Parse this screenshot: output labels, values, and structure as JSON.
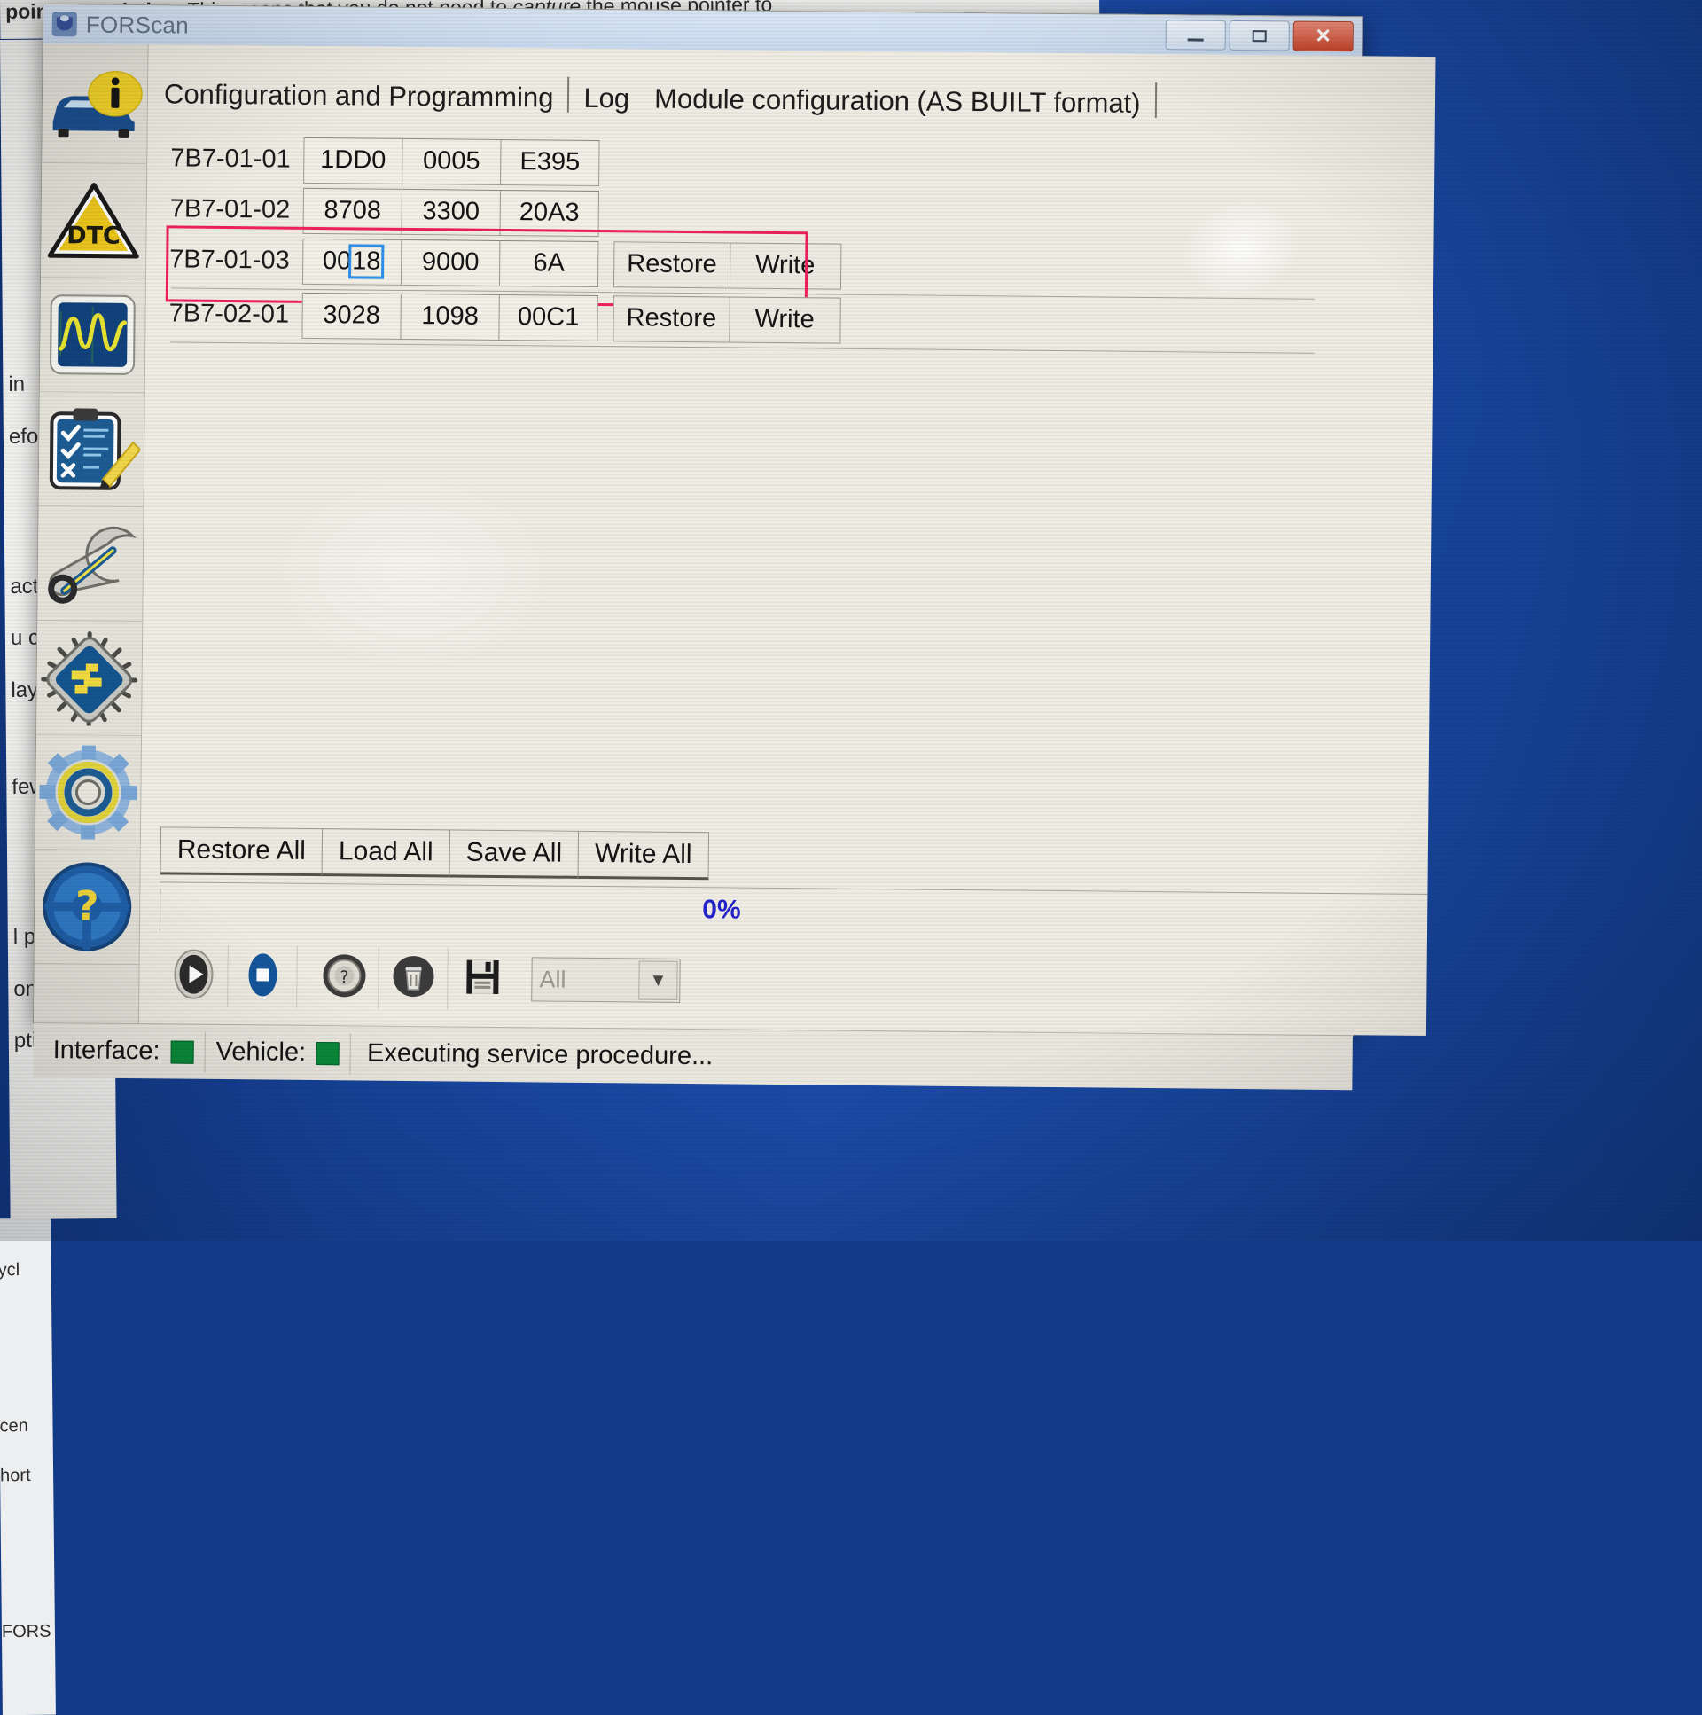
{
  "window": {
    "title": "FORScan",
    "app_icon": "forscan-logo-icon",
    "minimize_label": "",
    "maximize_label": "",
    "close_label": "✕"
  },
  "background": {
    "top_text_plain_1": "pointer emulation.",
    "top_text_plain_2": " This means that you do not need to ",
    "top_text_italic": "capture",
    "top_text_plain_3": " the mouse pointer to",
    "left_fragments": [
      "ycl",
      "cen",
      "hort",
      "FORS"
    ],
    "right_fragments": [
      "in",
      "efo",
      "acti",
      "u ca",
      "lays",
      "few",
      "l per",
      "omm",
      "ption"
    ]
  },
  "sidebar": {
    "items": [
      {
        "name": "vehicle-info",
        "icon": "car-info-icon"
      },
      {
        "name": "dtc-codes",
        "icon": "dtc-warning-triangle-icon"
      },
      {
        "name": "oscilloscope",
        "icon": "oscilloscope-icon"
      },
      {
        "name": "tests",
        "icon": "clipboard-checklist-pencil-icon"
      },
      {
        "name": "service-procedures",
        "icon": "wrench-icon"
      },
      {
        "name": "configuration-programming",
        "icon": "chip-icon"
      },
      {
        "name": "settings",
        "icon": "gear-icon"
      },
      {
        "name": "help",
        "icon": "steering-wheel-question-icon"
      }
    ]
  },
  "tabs": [
    {
      "label": "Configuration and Programming",
      "active": false
    },
    {
      "label": "Log",
      "active": false
    },
    {
      "label": "Module configuration (AS BUILT format)",
      "active": true
    }
  ],
  "asbuilt": {
    "rows": [
      {
        "id": "7B7-01-01",
        "values": [
          "1DD0",
          "0005",
          "E395"
        ],
        "has_buttons": false,
        "highlighted": false
      },
      {
        "id": "7B7-01-02",
        "values": [
          "8708",
          "3300",
          "20A3"
        ],
        "has_buttons": false,
        "highlighted": false
      },
      {
        "id": "7B7-01-03",
        "values": [
          "0018",
          "9000",
          "6A"
        ],
        "selection": {
          "cell": 0,
          "prefix": "00",
          "selected_text": "18"
        },
        "has_buttons": true,
        "restore_label": "Restore",
        "write_label": "Write",
        "highlighted": true
      },
      {
        "id": "7B7-02-01",
        "values": [
          "3028",
          "1098",
          "00C1"
        ],
        "has_buttons": true,
        "restore_label": "Restore",
        "write_label": "Write",
        "highlighted": false
      }
    ],
    "highlight_color": "#ee1f5c",
    "selection_color": "#2f8fe8"
  },
  "bottom_buttons": [
    {
      "label": "Restore All"
    },
    {
      "label": "Load All"
    },
    {
      "label": "Save All"
    },
    {
      "label": "Write All"
    }
  ],
  "progress": {
    "percent_label": "0%",
    "percent_color": "#2222cc",
    "value": 0
  },
  "toolbar": {
    "items": [
      {
        "name": "play-button",
        "icon": "play-icon"
      },
      {
        "name": "stop-button",
        "icon": "stop-icon"
      },
      {
        "name": "pause-unknown-button",
        "icon": "question-wheel-icon"
      },
      {
        "name": "clear-button",
        "icon": "trash-icon"
      },
      {
        "name": "save-button",
        "icon": "floppy-disk-icon"
      }
    ],
    "filter_combo": {
      "value": "All",
      "arrow": "▼"
    }
  },
  "statusbar": {
    "interface_label": "Interface:",
    "interface_led_color": "#0a8a3a",
    "vehicle_label": "Vehicle:",
    "vehicle_led_color": "#0a8a3a",
    "message": "Executing service procedure..."
  }
}
